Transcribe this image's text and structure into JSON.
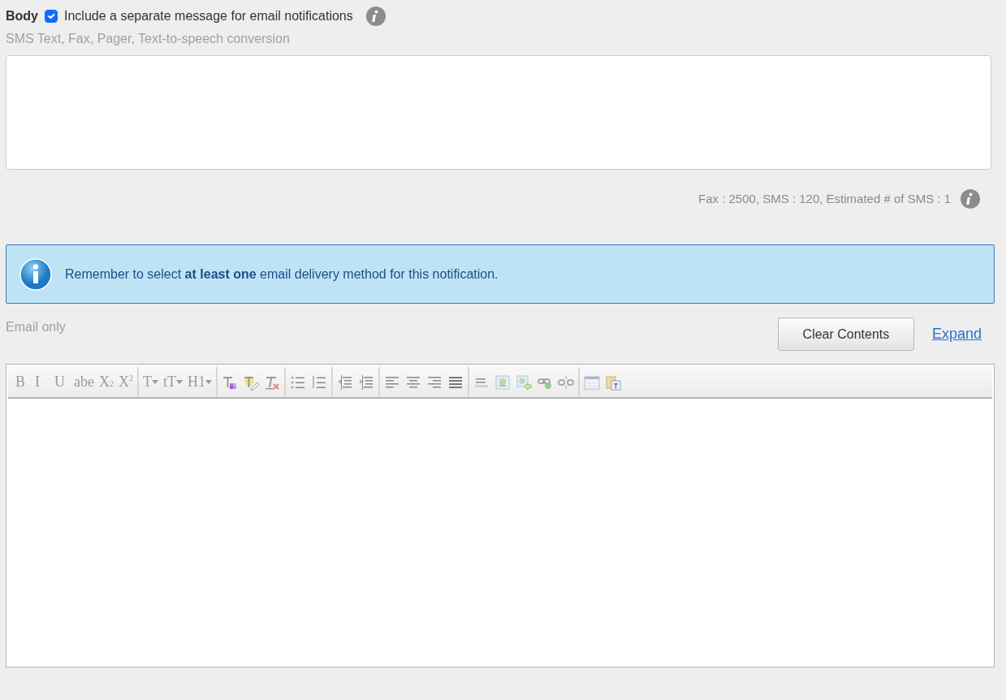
{
  "body_section": {
    "label": "Body",
    "separate_email": {
      "label": "Include a separate message for email notifications",
      "checked": true
    },
    "hint": "SMS Text, Fax, Pager, Text-to-speech conversion",
    "counter": "Fax : 2500, SMS : 120, Estimated # of SMS : 1"
  },
  "alert": {
    "text": "Remember to select **at least one** email delivery method for this notification."
  },
  "email_section": {
    "label": "Email only",
    "clear_button": "Clear Contents",
    "expand_link": "Expand",
    "toolbar": [
      [
        {
          "kind": "text",
          "label": "B"
        },
        {
          "kind": "text",
          "label": "I"
        },
        {
          "kind": "text",
          "label": "U"
        },
        {
          "kind": "text",
          "label": "abe"
        },
        {
          "kind": "text",
          "label": "X$_{2}$"
        },
        {
          "kind": "text",
          "label": "X$^{2}$"
        }
      ],
      [
        {
          "kind": "dropdown",
          "label": "T"
        },
        {
          "kind": "dropdown",
          "label": "tT"
        },
        {
          "kind": "dropdown",
          "label": "H1"
        }
      ],
      [
        {
          "kind": "icon"
        },
        {
          "kind": "icon"
        },
        {
          "kind": "icon"
        }
      ],
      [
        {
          "kind": "icon"
        },
        {
          "kind": "icon"
        }
      ],
      [
        {
          "kind": "icon"
        },
        {
          "kind": "icon"
        }
      ],
      [
        {
          "kind": "icon"
        },
        {
          "kind": "icon"
        },
        {
          "kind": "icon"
        },
        {
          "kind": "icon"
        }
      ],
      [
        {
          "kind": "icon"
        },
        {
          "kind": "icon"
        },
        {
          "kind": "icon"
        },
        {
          "kind": "icon"
        },
        {
          "kind": "icon"
        }
      ],
      [
        {
          "kind": "icon"
        },
        {
          "kind": "icon"
        }
      ]
    ]
  }
}
